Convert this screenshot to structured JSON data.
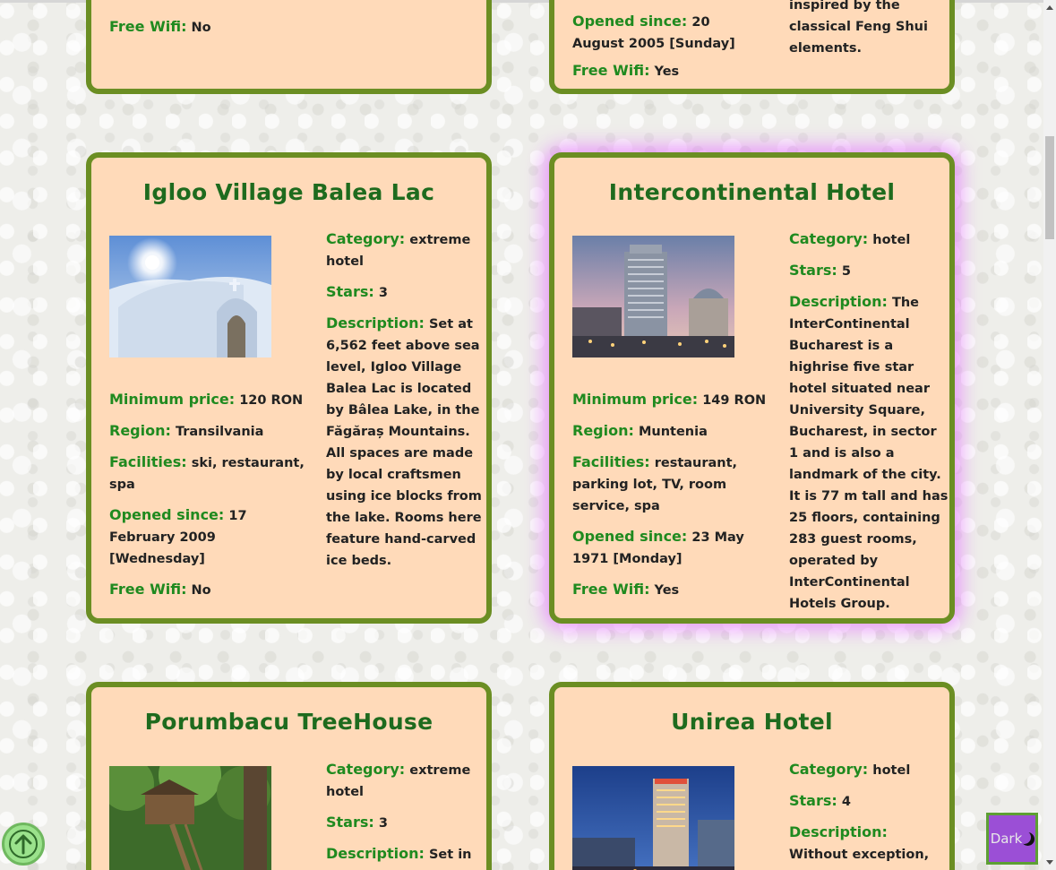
{
  "cards": [
    {
      "title": "",
      "left_fields": [
        {
          "label": "Free Wifi:",
          "value": "No"
        }
      ],
      "right_fields": []
    },
    {
      "title": "",
      "left_fields": [
        {
          "label": "Opened since:",
          "value": "20 August 2005 [Sunday]"
        },
        {
          "label": "Free Wifi:",
          "value": "Yes"
        }
      ],
      "right_text": "inspired by the classical Feng Shui elements."
    },
    {
      "title": "Igloo Village Balea Lac",
      "image": "ice-igloo-photo",
      "left_fields": [
        {
          "label": "Minimum price:",
          "value": "120 RON"
        },
        {
          "label": "Region:",
          "value": "Transilvania"
        },
        {
          "label": "Facilities:",
          "value": "ski, restaurant, spa"
        },
        {
          "label": "Opened since:",
          "value": "17 February 2009 [Wednesday]"
        },
        {
          "label": "Free Wifi:",
          "value": "No"
        }
      ],
      "right_fields": [
        {
          "label": "Category:",
          "value": "extreme hotel"
        },
        {
          "label": "Stars:",
          "value": "3"
        },
        {
          "label": "Description:",
          "value": "Set at 6,562 feet above sea level, Igloo Village Balea Lac is located by Bâlea Lake, in the Făgăraș Mountains. All spaces are made by local craftsmen using ice blocks from the lake. Rooms here feature hand-carved ice beds."
        }
      ]
    },
    {
      "title": "Intercontinental Hotel",
      "image": "tall-hotel-photo",
      "left_fields": [
        {
          "label": "Minimum price:",
          "value": "149 RON"
        },
        {
          "label": "Region:",
          "value": "Muntenia"
        },
        {
          "label": "Facilities:",
          "value": "restaurant, parking lot, TV, room service, spa"
        },
        {
          "label": "Opened since:",
          "value": "23 May 1971 [Monday]"
        },
        {
          "label": "Free Wifi:",
          "value": "Yes"
        }
      ],
      "right_fields": [
        {
          "label": "Category:",
          "value": "hotel"
        },
        {
          "label": "Stars:",
          "value": "5"
        },
        {
          "label": "Description:",
          "value": "The InterContinental Bucharest is a highrise five star hotel situated near University Square, Bucharest, in sector 1 and is also a landmark of the city. It is 77 m tall and has 25 floors, containing 283 guest rooms, operated by InterContinental Hotels Group."
        }
      ]
    },
    {
      "title": "Porumbacu TreeHouse",
      "image": "treehouse-photo",
      "right_fields": [
        {
          "label": "Category:",
          "value": "extreme hotel"
        },
        {
          "label": "Stars:",
          "value": "3"
        },
        {
          "label": "Description:",
          "value": "Set in a"
        }
      ]
    },
    {
      "title": "Unirea Hotel",
      "image": "night-hotel-photo",
      "right_fields": [
        {
          "label": "Category:",
          "value": "hotel"
        },
        {
          "label": "Stars:",
          "value": "4"
        },
        {
          "label": "Description:",
          "value": "Without exception, every"
        }
      ]
    }
  ],
  "buttons": {
    "dark_label": "Dark",
    "scroll_top_icon": "arrow-up-icon",
    "dark_icon": "moon-icon"
  },
  "colors": {
    "card_bg": "#ffdab9",
    "card_border": "#6b8e23",
    "title": "#1e6b1e",
    "label": "#1f8a1f",
    "highlight_glow": "#e678ff",
    "dark_button": "#9b4fd6"
  }
}
